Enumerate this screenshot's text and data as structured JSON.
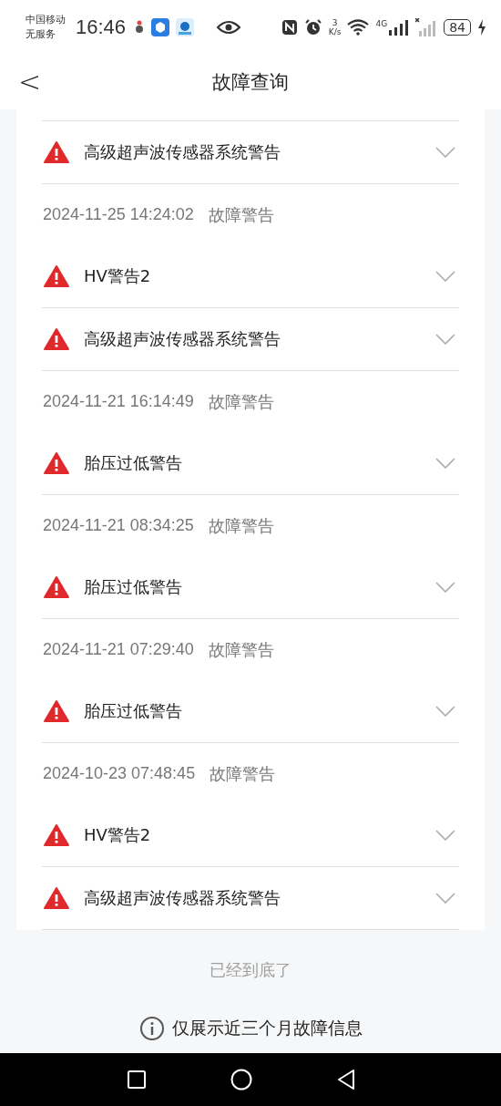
{
  "status_bar": {
    "carrier": "中国移动",
    "service": "无服务",
    "time": "16:46",
    "speed_value": "3",
    "speed_unit": "K/s",
    "network": "4G",
    "battery": "84"
  },
  "header": {
    "back": "<",
    "title": "故障查询"
  },
  "entries": [
    {
      "kind": "alert",
      "title": "高级超声波传感器系统警告",
      "expanded": false
    },
    {
      "kind": "date",
      "date": "2024-11-25 14:24:02",
      "type": "故障警告"
    },
    {
      "kind": "alert",
      "title": "HV警告2",
      "expanded": false
    },
    {
      "kind": "alert",
      "title": "高级超声波传感器系统警告",
      "expanded": false
    },
    {
      "kind": "date",
      "date": "2024-11-21 16:14:49",
      "type": "故障警告"
    },
    {
      "kind": "alert",
      "title": "胎压过低警告",
      "expanded": false
    },
    {
      "kind": "date",
      "date": "2024-11-21 08:34:25",
      "type": "故障警告"
    },
    {
      "kind": "alert",
      "title": "胎压过低警告",
      "expanded": false
    },
    {
      "kind": "date",
      "date": "2024-11-21 07:29:40",
      "type": "故障警告"
    },
    {
      "kind": "alert",
      "title": "胎压过低警告",
      "expanded": false
    },
    {
      "kind": "date",
      "date": "2024-10-23 07:48:45",
      "type": "故障警告"
    },
    {
      "kind": "alert",
      "title": "HV警告2",
      "expanded": false
    },
    {
      "kind": "alert",
      "title": "高级超声波传感器系统警告",
      "expanded": false
    }
  ],
  "end_text": "已经到底了",
  "notice": "仅展示近三个月故障信息"
}
